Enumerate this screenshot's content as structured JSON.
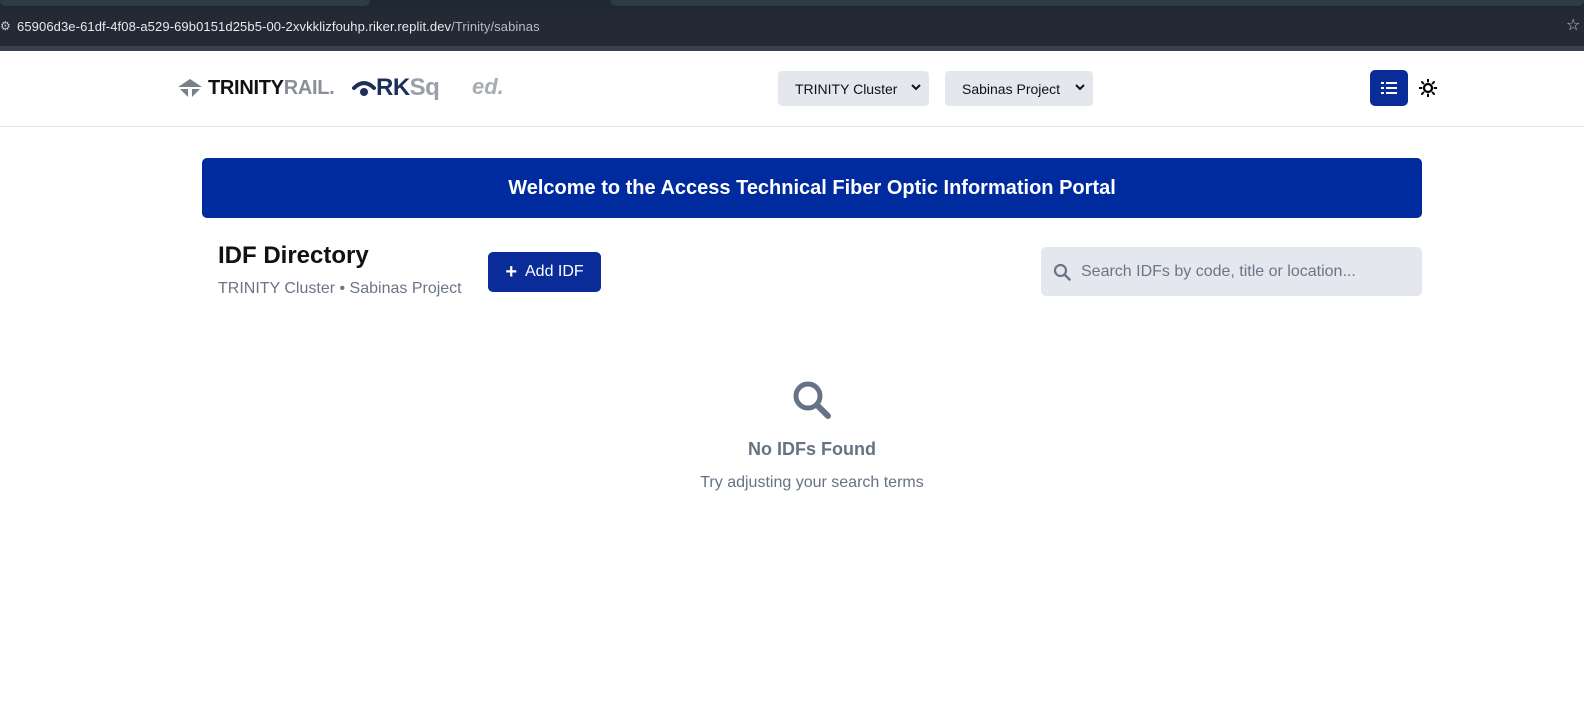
{
  "browser": {
    "url_host": "65906d3e-61df-4f08-a529-69b0151d25b5-00-2xvkklizfouhp.riker.replit.dev",
    "url_path": "/Trinity/sabinas"
  },
  "header": {
    "logos": {
      "trinity_main": "TRINITY",
      "trinity_rail": "RAIL",
      "trinity_dot": ".",
      "rksq_rk": "RK",
      "rksq_sq": "Sq",
      "ed": "ed."
    },
    "cluster_select": {
      "selected": "TRINITY Cluster"
    },
    "project_select": {
      "selected": "Sabinas Project"
    },
    "list_view_icon": "list-icon",
    "theme_toggle_icon": "sun-icon"
  },
  "banner": {
    "text": "Welcome to the Access Technical Fiber Optic Information Portal"
  },
  "directory": {
    "title": "IDF Directory",
    "subtitle": "TRINITY Cluster • Sabinas Project",
    "add_button_label": "Add IDF",
    "search_placeholder": "Search IDFs by code, title or location...",
    "search_value": ""
  },
  "empty_state": {
    "icon": "search-icon",
    "title": "No IDFs Found",
    "message": "Try adjusting your search terms"
  },
  "colors": {
    "primary": "#0a2c99",
    "banner": "#002b9e",
    "muted_text": "#667285",
    "field_bg": "#e4e8ee"
  }
}
